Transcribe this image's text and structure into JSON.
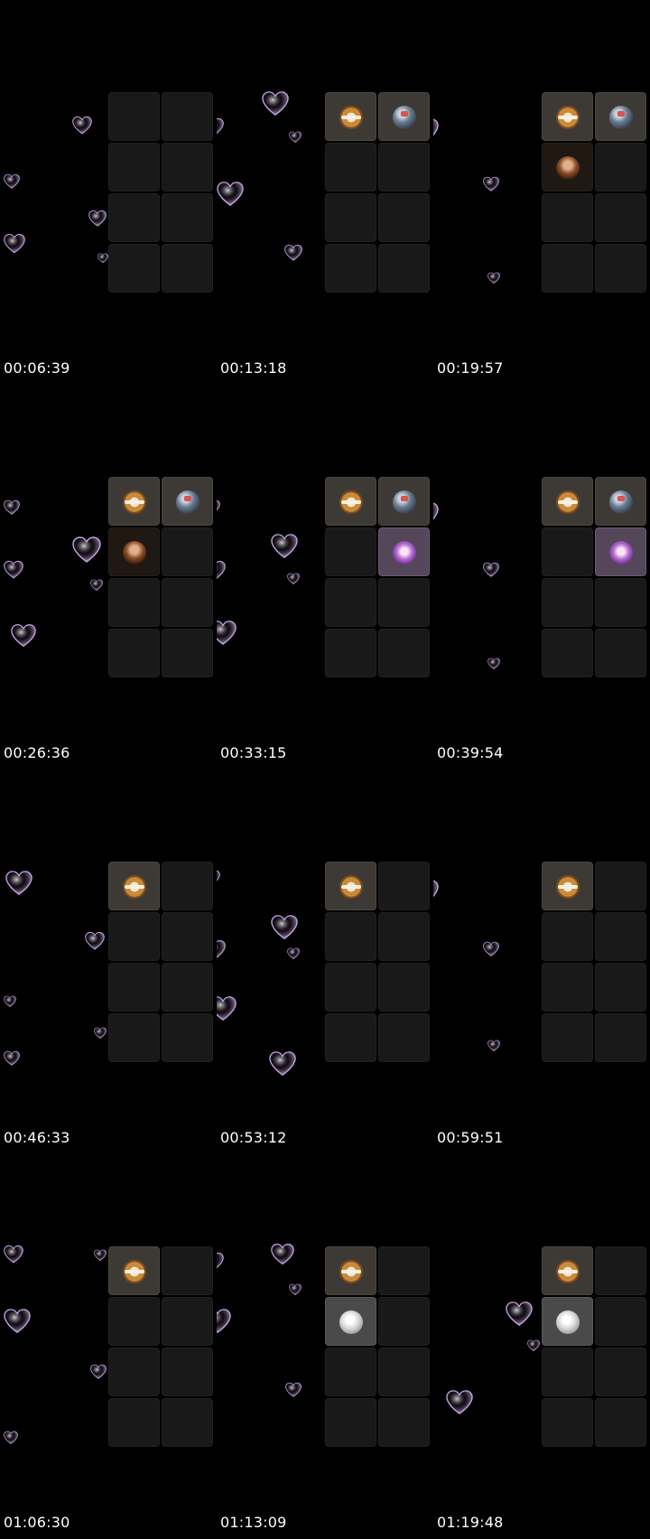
{
  "thumbnails": [
    {
      "timestamp": "00:06:39",
      "tiles": [
        "",
        "",
        "",
        "",
        "",
        "",
        "",
        ""
      ]
    },
    {
      "timestamp": "00:13:18",
      "tiles": [
        "logo",
        "world",
        "",
        "",
        "",
        "",
        "",
        ""
      ]
    },
    {
      "timestamp": "00:19:57",
      "tiles": [
        "logo",
        "world",
        "portrait",
        "",
        "",
        "",
        "",
        ""
      ]
    },
    {
      "timestamp": "00:26:36",
      "tiles": [
        "logo",
        "world",
        "portrait",
        "",
        "",
        "",
        "",
        ""
      ]
    },
    {
      "timestamp": "00:33:15",
      "tiles": [
        "logo",
        "world",
        "",
        "anime",
        "",
        "",
        "",
        ""
      ]
    },
    {
      "timestamp": "00:39:54",
      "tiles": [
        "logo",
        "world",
        "",
        "anime",
        "",
        "",
        "",
        ""
      ]
    },
    {
      "timestamp": "00:46:33",
      "tiles": [
        "logo",
        "",
        "",
        "",
        "",
        "",
        "",
        ""
      ]
    },
    {
      "timestamp": "00:53:12",
      "tiles": [
        "logo",
        "",
        "",
        "",
        "",
        "",
        "",
        ""
      ]
    },
    {
      "timestamp": "00:59:51",
      "tiles": [
        "logo",
        "",
        "",
        "",
        "",
        "",
        "",
        ""
      ]
    },
    {
      "timestamp": "01:06:30",
      "tiles": [
        "logo",
        "",
        "",
        "",
        "",
        "",
        "",
        ""
      ]
    },
    {
      "timestamp": "01:13:09",
      "tiles": [
        "logo",
        "",
        "moon",
        "",
        "",
        "",
        "",
        ""
      ]
    },
    {
      "timestamp": "01:19:48",
      "tiles": [
        "logo",
        "",
        "moon",
        "",
        "",
        "",
        "",
        ""
      ]
    }
  ],
  "icons": {
    "heart": "heart-bubble-icon",
    "logo": "circular-logo-avatar",
    "world": "globe-avatar",
    "portrait": "portrait-avatar",
    "anime": "anime-avatar",
    "moon": "moon-avatar"
  },
  "colors": {
    "background": "#000000",
    "tile": "#191919",
    "tile_active": "#3d3a36",
    "heart_pink": "#e9c6ee",
    "heart_blue": "#a8c4ff",
    "timestamp_text": "#ffffff"
  }
}
